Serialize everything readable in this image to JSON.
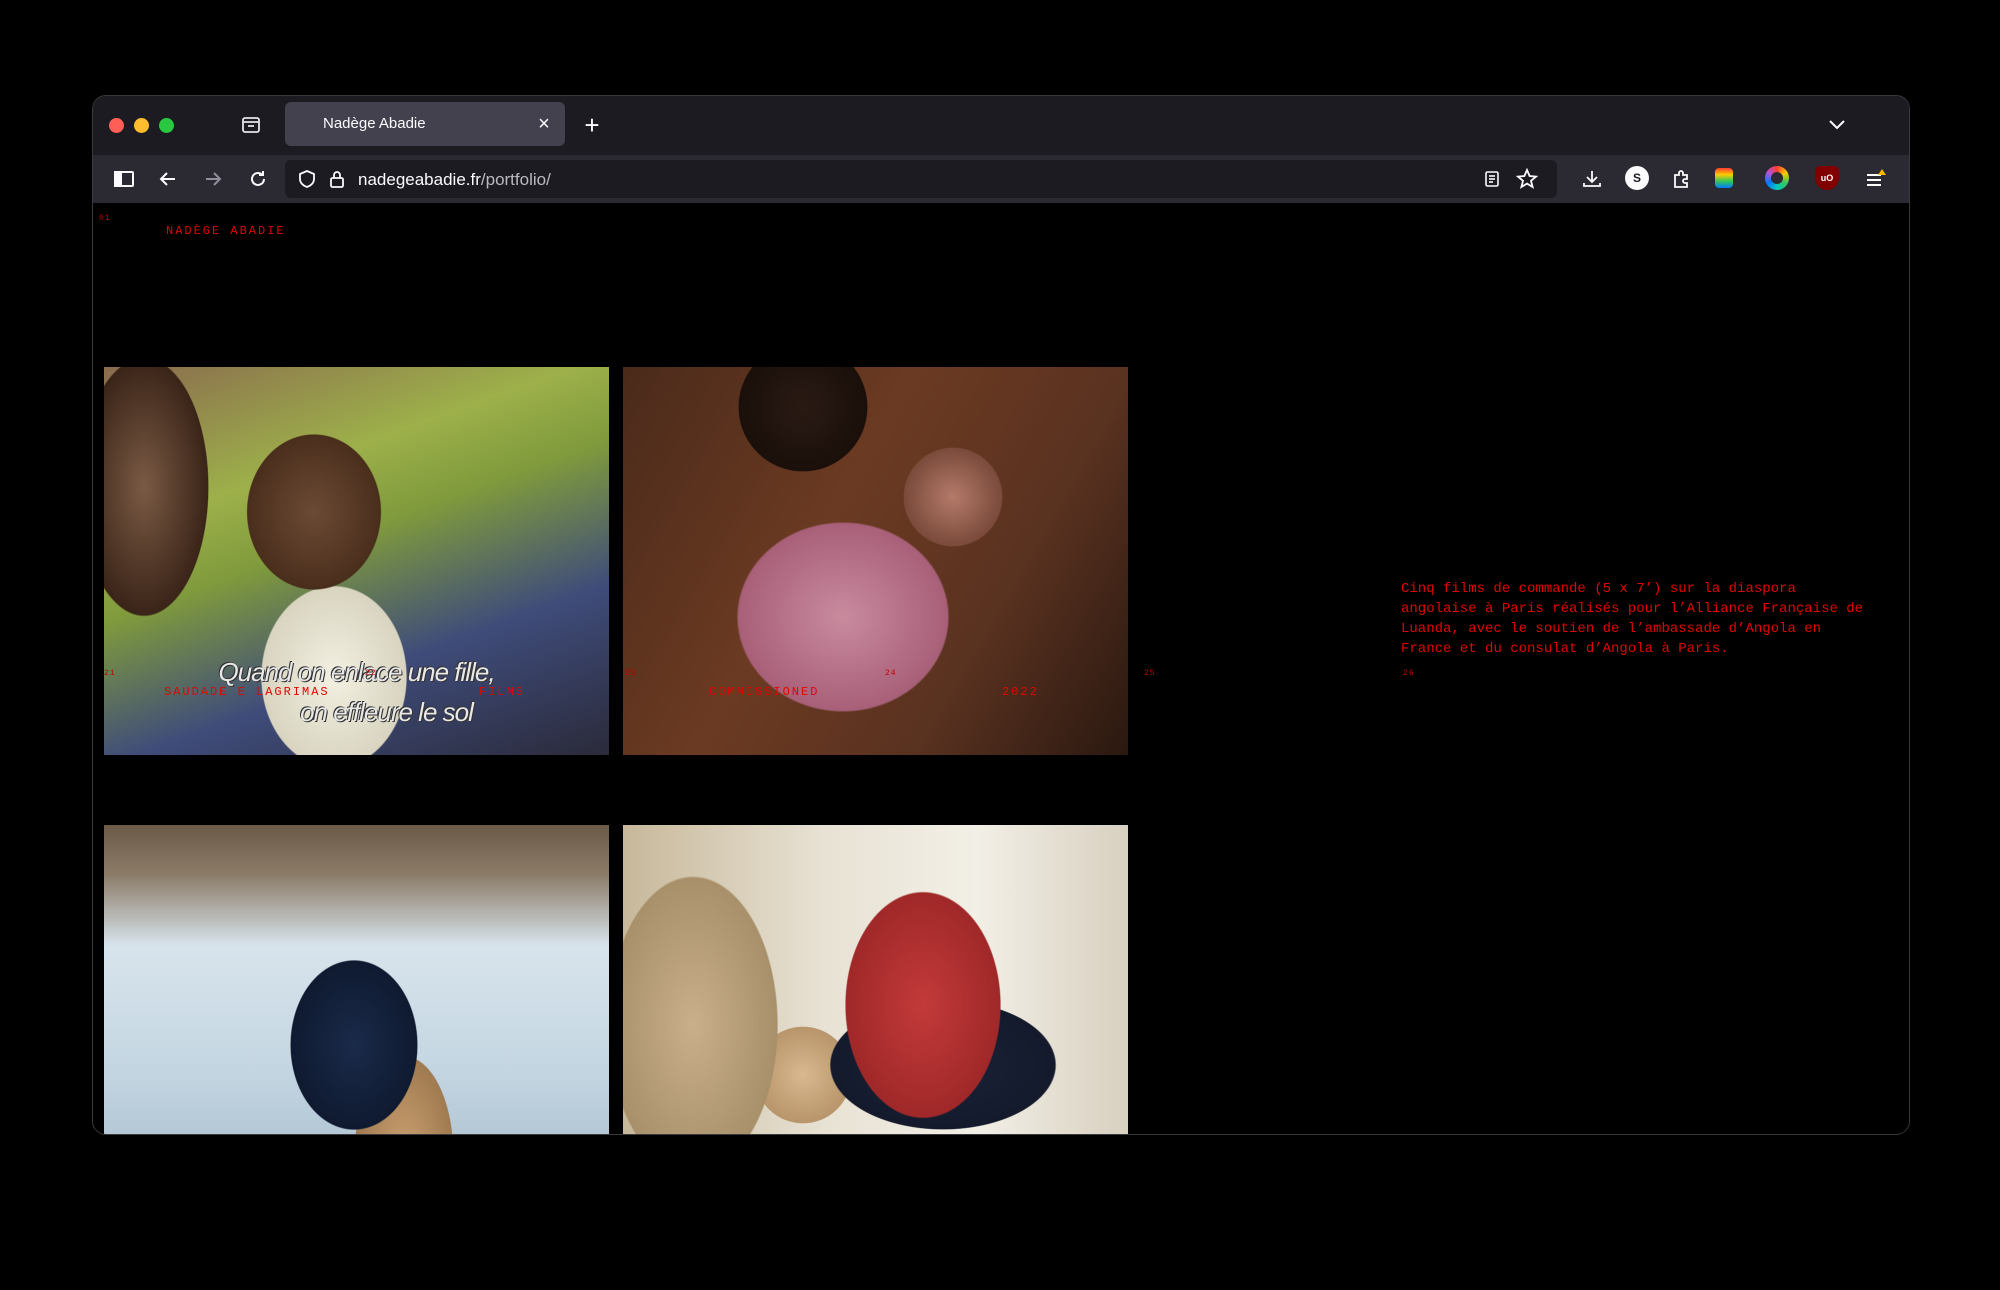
{
  "browser": {
    "tab_title": "Nadège Abadie",
    "url_domain": "nadegeabadie.fr",
    "url_path": "/portfolio/",
    "new_tab": "+",
    "close_tab": "×"
  },
  "page": {
    "index_top": "01",
    "site_title": "NADÈGE ABADIE",
    "meta_numbers": [
      "21",
      "22",
      "23",
      "24",
      "25",
      "26"
    ],
    "meta": {
      "title": "SAUDADE E LAGRIMAS",
      "category": "FILMS",
      "type": "COMMISSIONED",
      "year": "2022"
    },
    "description": "Cinq films de commande (5 x 7’) sur la diaspora angolaise à Paris réalisés pour l’Alliance Française de Luanda, avec le soutien de l’ambassade d’Angola en France et du consulat d’Angola à Paris.",
    "photo1_subtitle_line1": "Quand on enlace une fille,",
    "photo1_subtitle_line2": "on effleure le sol"
  },
  "colors": {
    "accent": "#e10600",
    "background": "#000000",
    "toolbar": "#2b2a33",
    "tabbar": "#1c1b22"
  }
}
